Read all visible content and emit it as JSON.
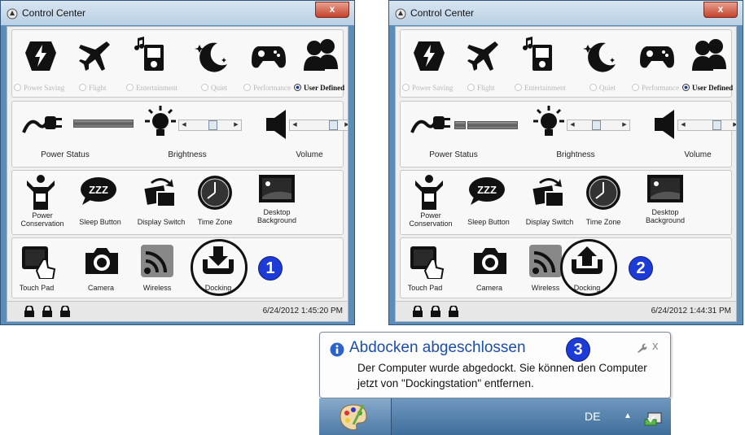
{
  "windows": [
    {
      "title": "Control Center",
      "close_label": "x",
      "modes": [
        {
          "label": "Power Saving",
          "selected": false
        },
        {
          "label": "Flight",
          "selected": false
        },
        {
          "label": "Entertainment",
          "selected": false
        },
        {
          "label": "Quiet",
          "selected": false
        },
        {
          "label": "Performance",
          "selected": false
        },
        {
          "label": "User Defined",
          "selected": true
        }
      ],
      "power_status_label": "Power Status",
      "brightness_label": "Brightness",
      "volume_label": "Volume",
      "row3": [
        "Power Conservation",
        "Sleep Button",
        "Display Switch",
        "Time Zone",
        "Desktop Background"
      ],
      "row4": [
        "Touch Pad",
        "Camera",
        "Wireless",
        "Docking"
      ],
      "sleep_glyph": "ZZZ",
      "datetime": "6/24/2012 1:45:20 PM",
      "docking_state": "undocked",
      "callout": "1"
    },
    {
      "title": "Control Center",
      "close_label": "x",
      "modes": [
        {
          "label": "Power Saving",
          "selected": false
        },
        {
          "label": "Flight",
          "selected": false
        },
        {
          "label": "Entertainment",
          "selected": false
        },
        {
          "label": "Quiet",
          "selected": false
        },
        {
          "label": "Performance",
          "selected": false
        },
        {
          "label": "User Defined",
          "selected": true
        }
      ],
      "power_status_label": "Power Status",
      "brightness_label": "Brightness",
      "volume_label": "Volume",
      "row3": [
        "Power Conservation",
        "Sleep Button",
        "Display Switch",
        "Time Zone",
        "Desktop Background"
      ],
      "row4": [
        "Touch Pad",
        "Camera",
        "Wireless",
        "Docking"
      ],
      "sleep_glyph": "ZZZ",
      "datetime": "6/24/2012 1:44:31 PM",
      "docking_state": "docked",
      "callout": "2"
    }
  ],
  "notification": {
    "title": "Abdocken abgeschlossen",
    "text": "Der Computer wurde abgedockt. Sie können den Computer jetzt von \"Dockingstation\" entfernen.",
    "callout": "3",
    "close_label": "x"
  },
  "taskbar": {
    "language": "DE"
  },
  "colors": {
    "window_frame": "#5b8db8",
    "callout_blue": "#1d3bd6",
    "balloon_title": "#1c4ea6"
  }
}
